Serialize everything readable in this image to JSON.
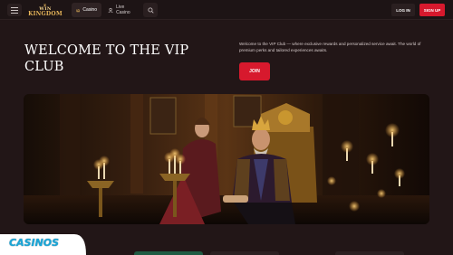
{
  "header": {
    "logo": {
      "line1": "WIN",
      "line2": "KINGDOM"
    },
    "tabs": [
      {
        "label": "Casino",
        "icon": "crown-icon",
        "active": true
      },
      {
        "label": "Live Casino",
        "icon": "person-icon",
        "active": false
      }
    ],
    "login_label": "LOG IN",
    "signup_label": "SIGN UP",
    "accent_color": "#d7192d"
  },
  "hero": {
    "title": "WELCOME TO THE VIP CLUB",
    "description": "Welcome to the VIP Club — where exclusive rewards and personalized service await. The world of premium perks and tailored experiences awaits.",
    "join_label": "JOIN"
  },
  "watermark": {
    "text": "CASINOS"
  }
}
